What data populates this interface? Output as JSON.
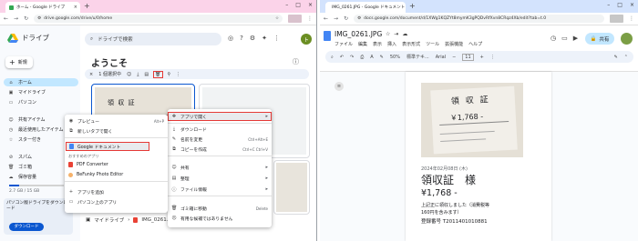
{
  "left": {
    "tab_title": "ホーム - Google ドライブ",
    "url": "drive.google.com/drive/u/0/home",
    "app_name": "ドライブ",
    "new_label": "新規",
    "search_placeholder": "ドライブで検索",
    "avatar_letter": "ト",
    "welcome": "ようこそ",
    "selected_count": "1 個選択中",
    "sidebar": [
      {
        "label": "ホーム",
        "icon": "home-icon"
      },
      {
        "label": "マイドライブ",
        "icon": "my-drive-icon"
      },
      {
        "label": "パソコン",
        "icon": "computer-icon"
      },
      {
        "label": "共有アイテム",
        "icon": "shared-icon"
      },
      {
        "label": "最近使用したアイテム",
        "icon": "clock-icon"
      },
      {
        "label": "スター付き",
        "icon": "star-icon"
      },
      {
        "label": "スパム",
        "icon": "spam-icon"
      },
      {
        "label": "ゴミ箱",
        "icon": "trash-icon"
      },
      {
        "label": "保存容量",
        "icon": "cloud-icon"
      }
    ],
    "storage_text": "2.7 GB / 15 GB",
    "promo_text": "パソコン版ドライブをダウンロード",
    "download_label": "ダウンロード",
    "thumb_text": "領 収 証",
    "breadcrumb": {
      "root": "マイドライブ",
      "sep": "›",
      "file": "IMG_0261.JPG"
    },
    "context_menu": {
      "preview": "プレビュー",
      "preview_shortcut": "Alt+P",
      "open_new_tab": "新しいタブで開く",
      "open_with": "アプリで開く",
      "download": "ダウンロード",
      "rename": "名前を変更",
      "rename_shortcut": "Ctrl+Alt+E",
      "make_copy": "コピーを作成",
      "make_copy_shortcut": "Ctrl+C Ctrl+V",
      "share": "共有",
      "organize": "整理",
      "file_info": "ファイル情報",
      "trash": "ゴミ箱に移動",
      "trash_shortcut": "Delete",
      "not_helpful": "有用な候補ではありません"
    },
    "open_with_menu": {
      "google_docs": "Google ドキュメント",
      "suggested_header": "おすすめのアプリ",
      "pdf_converter": "PDF Converter",
      "befunky": "BeFunky Photo Editor",
      "add_app": "アプリを追加",
      "computer_apps": "パソコン上のアプリ"
    }
  },
  "right": {
    "tab_title": "IMG_0261.JPG - Google ドキュメント",
    "url": "docs.google.com/document/d/1XWg1KQZYt8mymK3gPQDvRfXvn8CRqz4Xb/edit?tab=t.0",
    "doc_title": "IMG_0261.JPG",
    "menu": [
      "ファイル",
      "編集",
      "表示",
      "挿入",
      "表示形式",
      "ツール",
      "拡張機能",
      "ヘルプ"
    ],
    "share_label": "共有",
    "zoom": "50%",
    "style": "標準テキ...",
    "font": "Arial",
    "font_size": "11",
    "receipt_text": "領 収 証",
    "receipt_amount": "￥1,768 -",
    "doc_date": "2024年02月08日 (木)",
    "doc_heading": "領収証　様",
    "doc_amount": "¥1,768 -",
    "doc_line1": "上記正に領収しました（消費税等",
    "doc_line2": "160円を含みます）",
    "doc_reg": "登録番号 T2011401010881"
  },
  "colors": {
    "accent_blue": "#0b57d0",
    "selected_bg": "#c2e7ff",
    "highlight_red": "#e53935",
    "left_tabbar": "#fbd3e9",
    "right_tabbar": "#d3e3fd"
  }
}
